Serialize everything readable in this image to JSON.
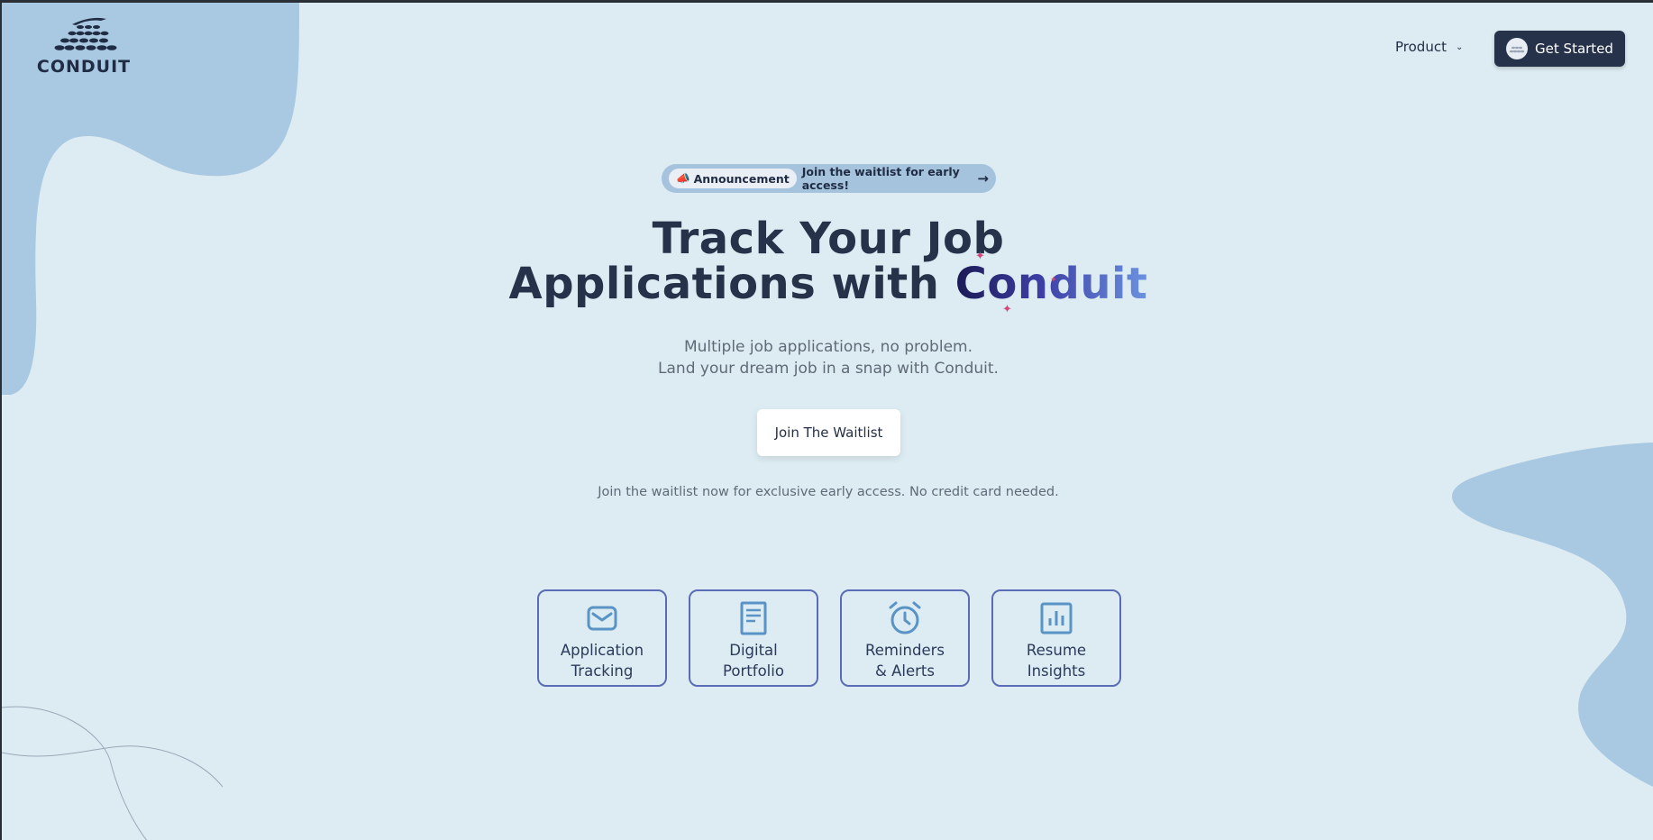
{
  "header": {
    "logo_text": "CONDUIT",
    "nav_product_label": "Product",
    "get_started_label": "Get Started"
  },
  "announcement": {
    "tag": "Announcement",
    "text": "Join the waitlist for early access!"
  },
  "hero": {
    "title_line1": "Track Your Job",
    "title_line2_prefix": "Applications with ",
    "title_brand": "Conduit",
    "subtitle_line1": "Multiple job applications, no problem.",
    "subtitle_line2": "Land your dream job in a snap with Conduit.",
    "cta_label": "Join The Waitlist",
    "note": "Join the waitlist now for exclusive early access. No credit card needed."
  },
  "features": [
    {
      "line1": "Application",
      "line2": "Tracking",
      "icon": "mail-icon"
    },
    {
      "line1": "Digital",
      "line2": "Portfolio",
      "icon": "document-icon"
    },
    {
      "line1": "Reminders",
      "line2": "& Alerts",
      "icon": "alarm-clock-icon"
    },
    {
      "line1": "Resume",
      "line2": "Insights",
      "icon": "bar-chart-icon"
    }
  ],
  "colors": {
    "background": "#dcecf2",
    "blob": "#a9c8e2",
    "primary_dark": "#26314a",
    "feature_border": "#5a6cb5",
    "icon": "#5a93c5"
  }
}
